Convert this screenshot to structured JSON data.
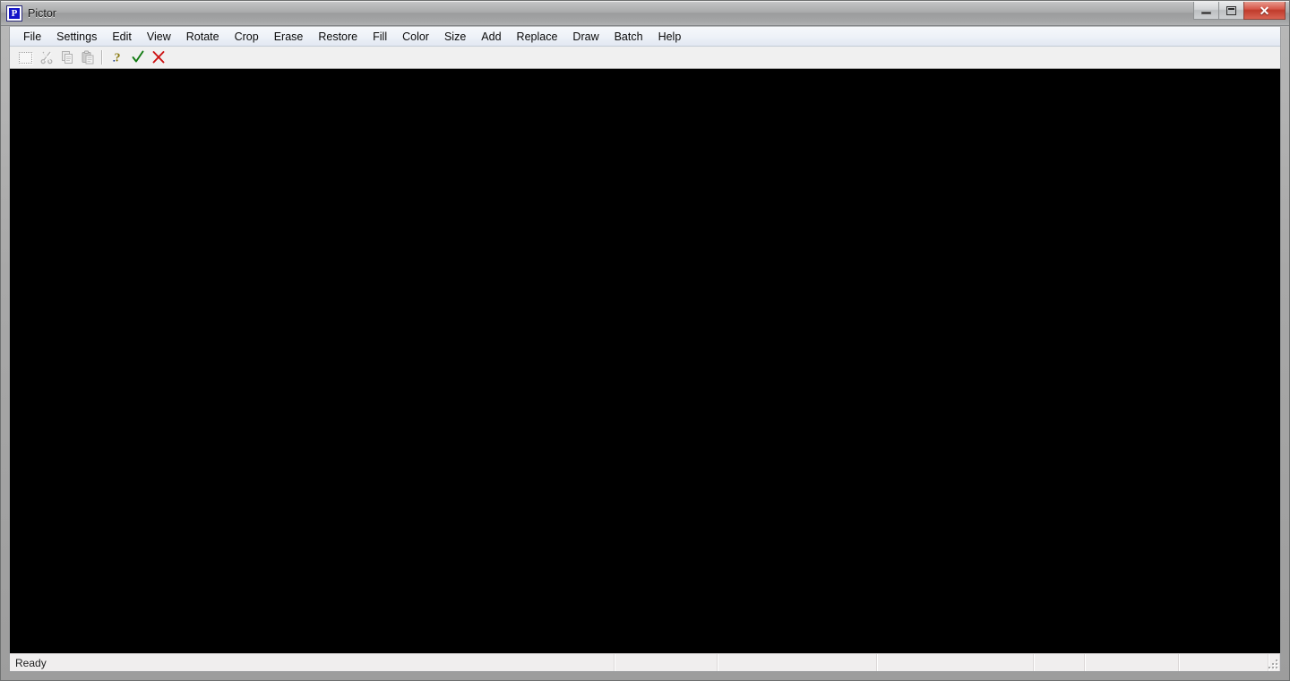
{
  "window": {
    "title": "Pictor",
    "icon": "app-p-icon",
    "icon_letter": "P",
    "caption_buttons": [
      {
        "name": "minimize",
        "label": "Minimize",
        "glyph": "minimize-glyph"
      },
      {
        "name": "maximize",
        "label": "Maximize",
        "glyph": "maximize-glyph"
      },
      {
        "name": "close",
        "label": "Close",
        "glyph": "✕"
      }
    ]
  },
  "menubar": {
    "items": [
      {
        "label": "File"
      },
      {
        "label": "Settings"
      },
      {
        "label": "Edit"
      },
      {
        "label": "View"
      },
      {
        "label": "Rotate"
      },
      {
        "label": "Crop"
      },
      {
        "label": "Erase"
      },
      {
        "label": "Restore"
      },
      {
        "label": "Fill"
      },
      {
        "label": "Color"
      },
      {
        "label": "Size"
      },
      {
        "label": "Add"
      },
      {
        "label": "Replace"
      },
      {
        "label": "Draw"
      },
      {
        "label": "Batch"
      },
      {
        "label": "Help"
      }
    ]
  },
  "toolbar": {
    "buttons": [
      {
        "name": "select-all-icon",
        "tooltip": "Select All",
        "enabled": false
      },
      {
        "name": "cut-icon",
        "tooltip": "Cut",
        "enabled": false
      },
      {
        "name": "copy-icon",
        "tooltip": "Copy",
        "enabled": false
      },
      {
        "name": "paste-icon",
        "tooltip": "Paste",
        "enabled": false
      },
      {
        "name": "help-icon",
        "tooltip": "Help",
        "enabled": true
      },
      {
        "name": "confirm-check-icon",
        "tooltip": "Apply",
        "enabled": true
      },
      {
        "name": "cancel-x-icon",
        "tooltip": "Cancel",
        "enabled": true
      }
    ]
  },
  "canvas": {
    "background_color": "#000000",
    "content": ""
  },
  "statusbar": {
    "message": "Ready",
    "panes": [
      "Ready",
      "",
      "",
      "",
      "",
      "",
      "",
      ""
    ],
    "grip": "resize-grip"
  },
  "colors": {
    "titlebar_text": "#1a1a1a",
    "app_icon_blue": "#1414c8",
    "close_button_red": "#c03c2c",
    "check_green": "#118811",
    "x_red": "#cc1111",
    "help_yellow": "#8a7a10",
    "canvas_black": "#000000",
    "menubar_bg": "#eef2f8",
    "toolbar_bg": "#f0f0f0",
    "statusbar_bg": "#f0eeee"
  }
}
